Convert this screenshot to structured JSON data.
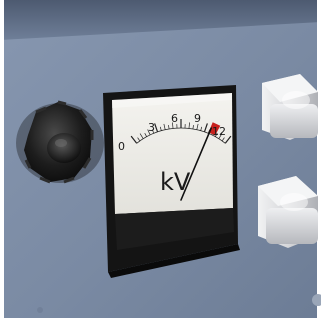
{
  "meter": {
    "unit": "kV",
    "scale_labels": [
      "0",
      "3",
      "6",
      "9",
      "12"
    ],
    "scale_min": 0,
    "scale_max": 12,
    "needle_value": 9.6,
    "red_zone_start": 9.5,
    "red_zone_end": 10.4
  },
  "colors": {
    "panel": "#7f8fa8",
    "panel_shadow": "#5c6b82",
    "meter_face": "#f2f1ec",
    "meter_bezel": "#141414",
    "needle": "#111111",
    "red_zone": "#c8201c",
    "terminal": "#d9dadc",
    "knob": "#1b1b1b"
  }
}
